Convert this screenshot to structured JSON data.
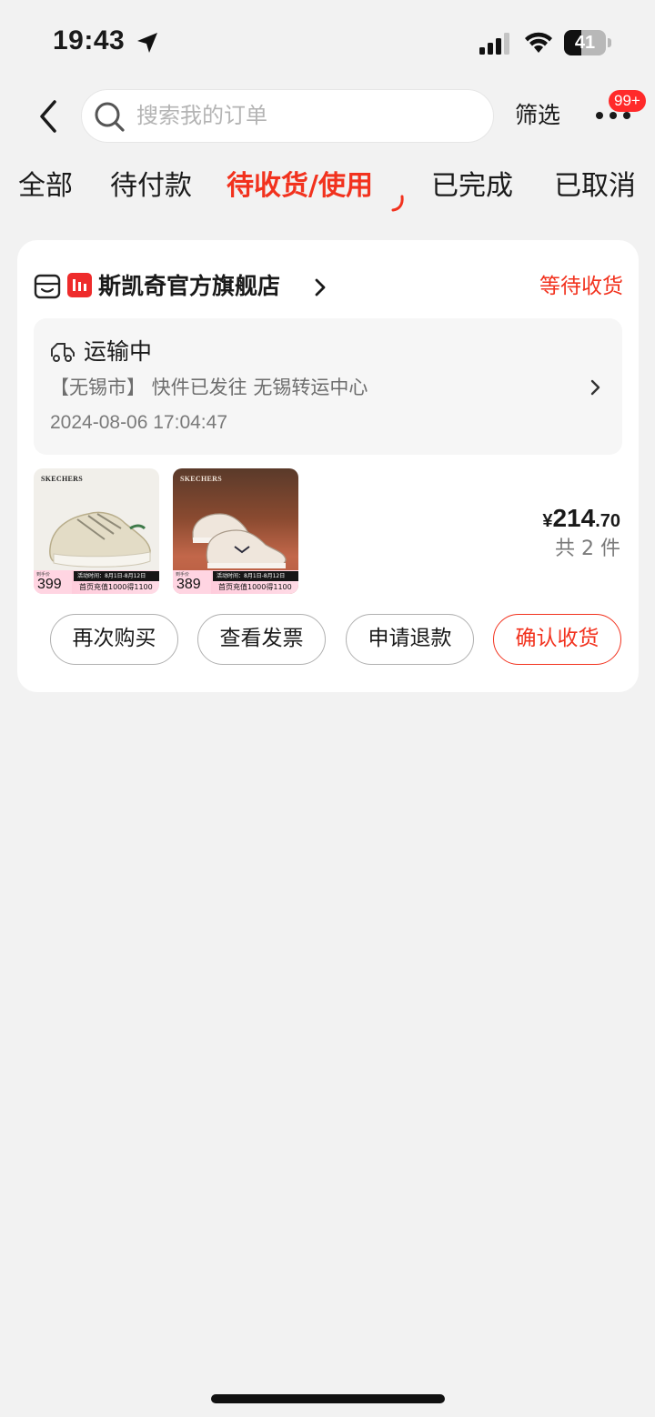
{
  "status_bar": {
    "time": "19:43",
    "battery_level": "41",
    "battery_fraction": 0.41
  },
  "search": {
    "placeholder": "搜索我的订单"
  },
  "nav": {
    "filter_label": "筛选",
    "badge": "99+"
  },
  "tabs": [
    {
      "label": "全部",
      "active": false
    },
    {
      "label": "待付款",
      "active": false
    },
    {
      "label": "待收货/使用",
      "active": true
    },
    {
      "label": "已完成",
      "active": false
    },
    {
      "label": "已取消",
      "active": false
    }
  ],
  "order": {
    "shop_name": "斯凯奇官方旗舰店",
    "status": "等待收货",
    "logistics": {
      "title": "运输中",
      "detail": "【无锡市】 快件已发往 无锡转运中心",
      "time": "2024-08-06 17:04:47"
    },
    "products": [
      {
        "brand": "SKECHERS",
        "price_tag": "到手价",
        "price": "399",
        "promo_top": "活动时间：8月1日-8月12日",
        "promo_text": "首页充值1000得1100"
      },
      {
        "brand": "SKECHERS",
        "price_tag": "到手价",
        "price": "389",
        "promo_top": "活动时间：8月1日-8月12日",
        "promo_text": "首页充值1000得1100"
      }
    ],
    "price_symbol": "¥",
    "price_int": "214",
    "price_dec": ".70",
    "quantity": "共 2 件",
    "actions": {
      "rebuy": "再次购买",
      "invoice": "查看发票",
      "refund": "申请退款",
      "confirm": "确认收货"
    }
  },
  "colors": {
    "accent": "#f2321e",
    "background": "#f2f2f2",
    "card": "#ffffff"
  }
}
